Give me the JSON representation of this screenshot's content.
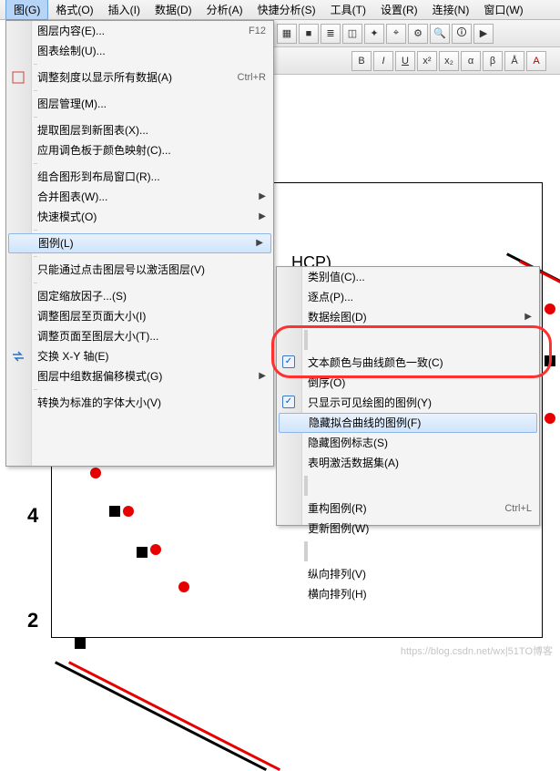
{
  "menubar": {
    "items": [
      {
        "label": "图(G)"
      },
      {
        "label": "格式(O)"
      },
      {
        "label": "插入(I)"
      },
      {
        "label": "数据(D)"
      },
      {
        "label": "分析(A)"
      },
      {
        "label": "快捷分析(S)"
      },
      {
        "label": "工具(T)"
      },
      {
        "label": "设置(R)"
      },
      {
        "label": "连接(N)"
      },
      {
        "label": "窗口(W)"
      }
    ]
  },
  "toolbar1_icons": [
    "film",
    "grid",
    "bars",
    "hist",
    "xy",
    "target",
    "zoom",
    "cfg",
    "play",
    "eye"
  ],
  "toolbar2": {
    "bold": "B",
    "italic": "I",
    "underline": "U",
    "sup": "x²",
    "sub": "x₂",
    "a1": "A",
    "a2": "A",
    "alpha": "α",
    "beta": "β",
    "ab": "Å"
  },
  "dropdown": {
    "items": [
      {
        "label": "图层内容(E)...",
        "shortcut": "F12"
      },
      {
        "label": "图表绘制(U)..."
      },
      {
        "sep": true
      },
      {
        "label": "调整刻度以显示所有数据(A)",
        "shortcut": "Ctrl+R",
        "icon": "rescale"
      },
      {
        "sep": true
      },
      {
        "label": "图层管理(M)..."
      },
      {
        "sep": true
      },
      {
        "label": "提取图层到新图表(X)..."
      },
      {
        "label": "应用调色板于颜色映射(C)..."
      },
      {
        "sep": true
      },
      {
        "label": "组合图形到布局窗口(R)..."
      },
      {
        "label": "合并图表(W)...",
        "submenu": true
      },
      {
        "label": "快速模式(O)",
        "submenu": true
      },
      {
        "sep": true
      },
      {
        "label": "图例(L)",
        "submenu": true,
        "highlight": true
      },
      {
        "sep": true
      },
      {
        "label": "只能通过点击图层号以激活图层(V)"
      },
      {
        "sep": true
      },
      {
        "label": "固定缩放因子...(S)"
      },
      {
        "label": "调整图层至页面大小(I)"
      },
      {
        "label": "调整页面至图层大小(T)..."
      },
      {
        "label": "交换 X-Y 轴(E)",
        "icon": "swap"
      },
      {
        "label": "图层中组数据偏移模式(G)",
        "submenu": true
      },
      {
        "sep": true
      },
      {
        "label": "转换为标准的字体大小(V)"
      }
    ]
  },
  "submenu": {
    "items": [
      {
        "label": "类别值(C)..."
      },
      {
        "label": "逐点(P)..."
      },
      {
        "label": "数据绘图(D)",
        "submenu": true
      },
      {
        "sep": true
      },
      {
        "label": "文本颜色与曲线颜色一致(C)",
        "check": true
      },
      {
        "label": "倒序(O)"
      },
      {
        "label": "只显示可见绘图的图例(Y)",
        "check": true
      },
      {
        "label": "隐藏拟合曲线的图例(F)",
        "highlight": true
      },
      {
        "label": "隐藏图例标志(S)"
      },
      {
        "label": "表明激活数据集(A)"
      },
      {
        "sep": true
      },
      {
        "label": "重构图例(R)",
        "shortcut": "Ctrl+L"
      },
      {
        "label": "更新图例(W)"
      },
      {
        "sep": true
      },
      {
        "label": "纵向排列(V)"
      },
      {
        "label": "横向排列(H)"
      }
    ]
  },
  "axis": {
    "y4": "4",
    "y2": "2"
  },
  "hcp": "HCP)",
  "watermark": "https://blog.csdn.net/wx|51TO博客"
}
